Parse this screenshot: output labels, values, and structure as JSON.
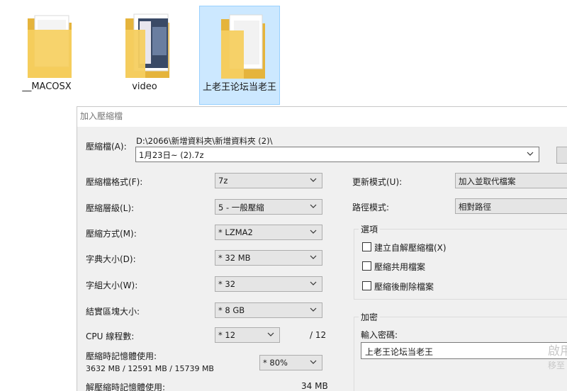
{
  "folders": [
    {
      "name": "__MACOSX"
    },
    {
      "name": "video"
    },
    {
      "name": "上老王论坛当老王"
    }
  ],
  "dialog": {
    "title": "加入壓縮檔",
    "archive_label": "壓縮檔(A):",
    "archive_path": "D:\\2066\\新增資料夾\\新增資料夾 (2)\\",
    "archive_name": "1月23日~ (2).7z",
    "browse_label": "...",
    "format_label": "壓縮檔格式(F):",
    "format_value": "7z",
    "level_label": "壓縮層級(L):",
    "level_value": "5 - 一般壓縮",
    "method_label": "壓縮方式(M):",
    "method_value": "* LZMA2",
    "dict_label": "字典大小(D):",
    "dict_value": "* 32 MB",
    "word_label": "字組大小(W):",
    "word_value": "* 32",
    "solid_label": "結實區塊大小:",
    "solid_value": "* 8 GB",
    "cpu_label": "CPU 線程數:",
    "cpu_value": "* 12",
    "cpu_total": "/ 12",
    "mem_comp_label": "壓縮時記憶體使用:",
    "mem_comp_detail": "3632 MB / 12591 MB / 15739 MB",
    "mem_comp_value": "* 80%",
    "mem_decomp_label": "解壓縮時記憶體使用:",
    "mem_decomp_value": "34 MB",
    "update_label": "更新模式(U):",
    "update_value": "加入並取代檔案",
    "path_label": "路徑模式:",
    "path_value": "相對路徑",
    "options_title": "選項",
    "opt_sfx": "建立自解壓縮檔(X)",
    "opt_shared": "壓縮共用檔案",
    "opt_delete": "壓縮後刪除檔案",
    "encrypt_title": "加密",
    "password_label": "輸入密碼:",
    "password_value": "上老王论坛当老王",
    "watermark_1": "啟用",
    "watermark_2": "移至"
  },
  "colors": {
    "selection": "#cce8ff",
    "dialog_bg": "#f0f0f0",
    "folder_yellow": "#f4c24a"
  }
}
